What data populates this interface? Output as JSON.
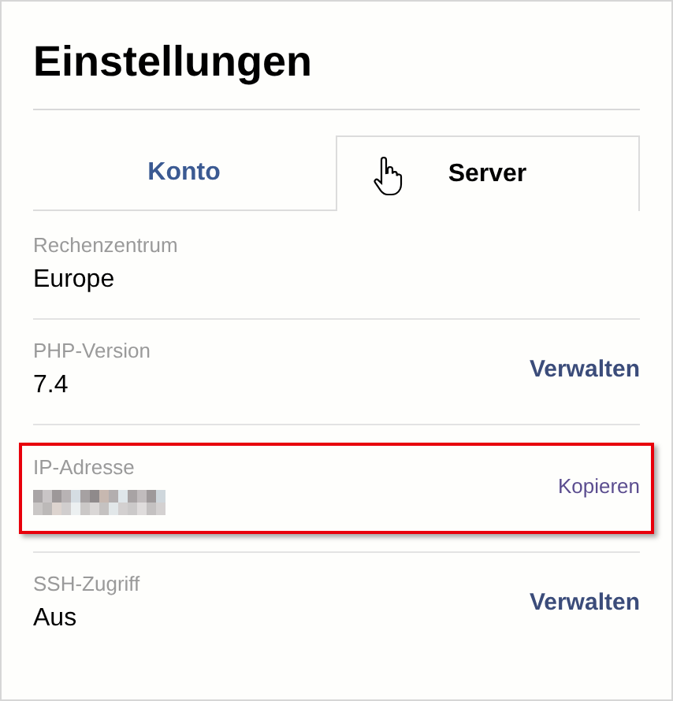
{
  "title": "Einstellungen",
  "tabs": [
    {
      "label": "Konto",
      "selected": false
    },
    {
      "label": "Server",
      "selected": true
    }
  ],
  "rows": [
    {
      "label": "Rechenzentrum",
      "value": "Europe",
      "redacted": false,
      "highlighted": false
    },
    {
      "label": "PHP-Version",
      "value": "7.4",
      "redacted": false,
      "highlighted": false,
      "action": {
        "label": "Verwalten",
        "kind": "strong"
      }
    },
    {
      "label": "IP-Adresse",
      "redacted": true,
      "highlighted": true,
      "action": {
        "label": "Kopieren",
        "kind": "plain"
      }
    },
    {
      "label": "SSH-Zugriff",
      "value": "Aus",
      "redacted": false,
      "highlighted": false,
      "action": {
        "label": "Verwalten",
        "kind": "strong"
      }
    }
  ]
}
